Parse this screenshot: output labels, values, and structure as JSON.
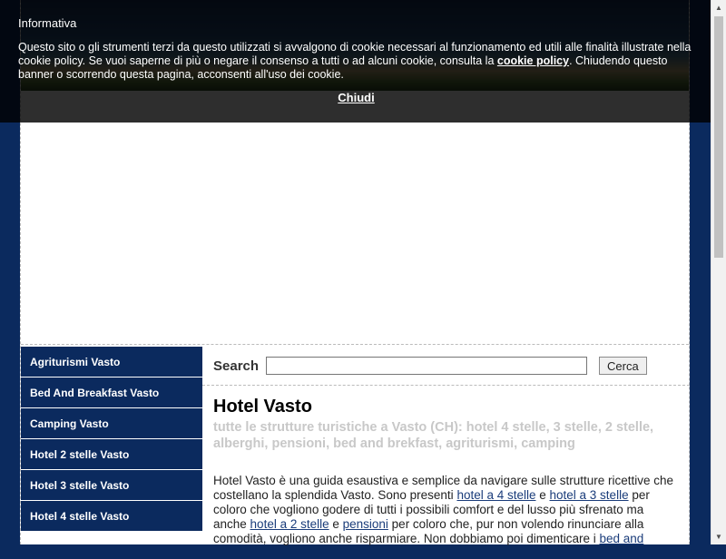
{
  "cookie": {
    "title": "Informativa",
    "text_before": "Questo sito o gli strumenti terzi da questo utilizzati si avvalgono di cookie necessari al funzionamento ed utili alle finalità illustrate nella cookie policy. Se vuoi saperne di più o negare il consenso a tutti o ad alcuni cookie, consulta la ",
    "policy_link": "cookie policy",
    "text_after": ". Chiudendo questo banner o scorrendo questa pagina, acconsenti all'uso dei cookie.",
    "close_label": "Chiudi"
  },
  "sidebar": {
    "items": [
      {
        "label": "Agriturismi Vasto"
      },
      {
        "label": "Bed And Breakfast Vasto"
      },
      {
        "label": "Camping Vasto"
      },
      {
        "label": "Hotel 2 stelle Vasto"
      },
      {
        "label": "Hotel 3 stelle Vasto"
      },
      {
        "label": "Hotel 4 stelle Vasto"
      }
    ]
  },
  "search": {
    "label": "Search",
    "value": "",
    "button_label": "Cerca"
  },
  "content": {
    "title": "Hotel Vasto",
    "subtitle": "tutte le strutture turistiche a Vasto (CH): hotel 4 stelle, 3 stelle, 2 stelle, alberghi, pensioni, bed and brekfast, agriturismi, camping",
    "intro": {
      "t1": "Hotel Vasto è una guida esaustiva e semplice da navigare sulle strutture ricettive che costellano la splendida Vasto. Sono presenti ",
      "l1": "hotel a 4 stelle",
      "t2": " e ",
      "l2": "hotel a 3 stelle",
      "t3": " per coloro che vogliono godere di tutti i possibili comfort e del lusso più sfrenato ma anche ",
      "l3": "hotel a 2 stelle",
      "t4": " e ",
      "l4": "pensioni",
      "t5": " per coloro che, pur non volendo rinunciare alla comodità, vogliono anche risparmiare. Non dobbiamo poi dimenticare i ",
      "l5": "bed and"
    }
  },
  "colors": {
    "background": "#0b2a5e",
    "sidebar": "#0b2a5e",
    "link": "#1a3c7a",
    "subtitle": "#c8c8c8"
  }
}
